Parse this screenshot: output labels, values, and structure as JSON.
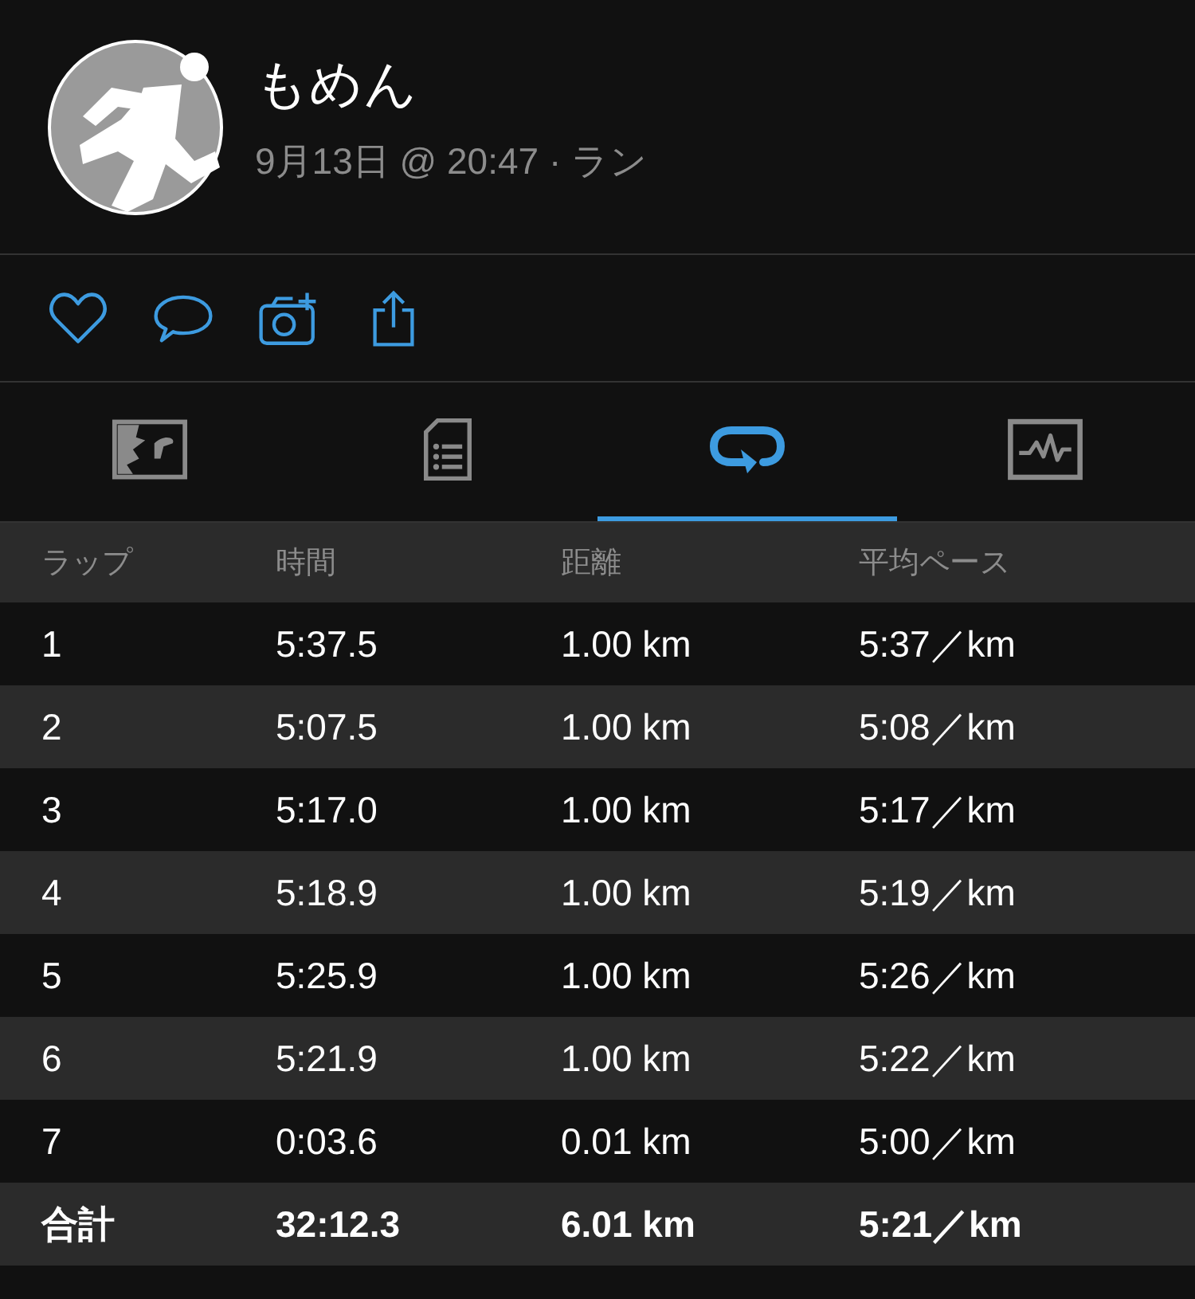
{
  "activity": {
    "user_name": "もめん",
    "subtitle": "9月13日 @ 20:47 · ラン"
  },
  "actions": [
    {
      "kind": "like"
    },
    {
      "kind": "comment"
    },
    {
      "kind": "photo"
    },
    {
      "kind": "share"
    }
  ],
  "tabs": [
    {
      "kind": "map",
      "selected": false
    },
    {
      "kind": "details",
      "selected": false
    },
    {
      "kind": "laps",
      "selected": true
    },
    {
      "kind": "chart",
      "selected": false
    }
  ],
  "table": {
    "columns": [
      "ラップ",
      "時間",
      "距離",
      "平均ペース"
    ],
    "rows": [
      [
        "1",
        "5:37.5",
        "1.00 km",
        "5:37／km"
      ],
      [
        "2",
        "5:07.5",
        "1.00 km",
        "5:08／km"
      ],
      [
        "3",
        "5:17.0",
        "1.00 km",
        "5:17／km"
      ],
      [
        "4",
        "5:18.9",
        "1.00 km",
        "5:19／km"
      ],
      [
        "5",
        "5:25.9",
        "1.00 km",
        "5:26／km"
      ],
      [
        "6",
        "5:21.9",
        "1.00 km",
        "5:22／km"
      ],
      [
        "7",
        "0:03.6",
        "0.01 km",
        "5:00／km"
      ]
    ],
    "total": [
      "合計",
      "32:12.3",
      "6.01 km",
      "5:21／km"
    ]
  }
}
